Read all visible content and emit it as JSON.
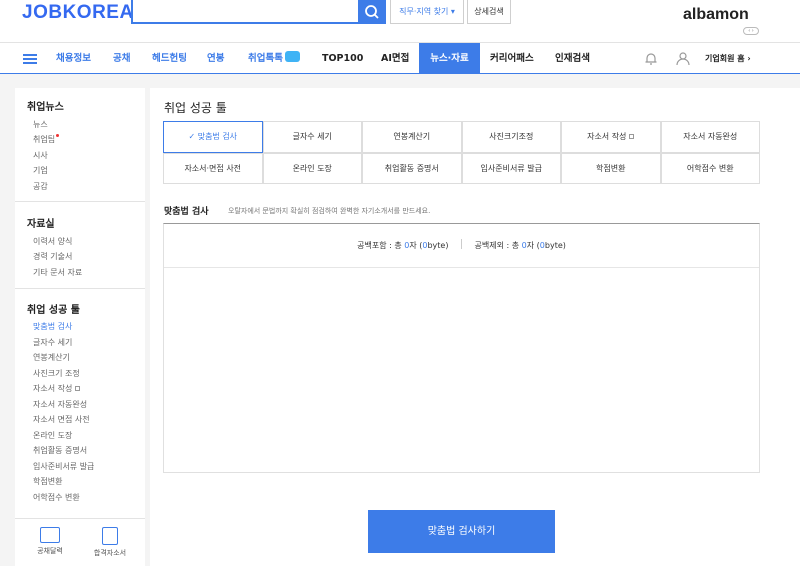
{
  "header": {
    "logo": "JOBKOREA",
    "search_placeholder": "",
    "job_region_button": "직무·지역 찾기 ▾",
    "detail_search_button": "상세검색",
    "albamon_logo": "albamon",
    "albamon_toggle": "‹ ›"
  },
  "nav": {
    "items": [
      "채용정보",
      "공채",
      "헤드헌팅",
      "연봉",
      "취업톡톡",
      "TOP100",
      "AI면접",
      "뉴스·자료",
      "커리어패스",
      "인재검색"
    ],
    "corporate_home": "기업회원 홈 ›"
  },
  "sidebar": {
    "news_title": "취업뉴스",
    "news_items": [
      "뉴스",
      "취업팁",
      "시사",
      "기업",
      "공감"
    ],
    "resource_title": "자료실",
    "resource_items": [
      "이력서 양식",
      "경력 기술서",
      "기타 문서 자료"
    ],
    "tools_title": "취업 성공 툴",
    "tools_items": [
      "맞춤법 검사",
      "글자수 세기",
      "연봉계산기",
      "사진크기 조정",
      "자소서 작성",
      "자소서 자동완성",
      "자소서 면접 사전",
      "온라인 도장",
      "취업활동 증명서",
      "입사준비서류 발급",
      "학점변환",
      "어학점수 변환"
    ],
    "bottom_tools": [
      "공채달력",
      "합격자소서"
    ]
  },
  "main": {
    "title": "취업 성공 툴",
    "tools_row1": [
      "맞춤법 검사",
      "글자수 세기",
      "연봉계산기",
      "사진크기조정",
      "자소서 작성",
      "자소서 자동완성"
    ],
    "tools_row2": [
      "자소서·면접 사전",
      "온라인 도장",
      "취업활동 증명서",
      "입사준비서류 발급",
      "학점변환",
      "어학점수 변환"
    ],
    "section_title": "맞춤법 검사",
    "section_desc": "오탈자에서 문법까지 확실히 점검하여 완벽한 자기소개서를 만드세요.",
    "count_with_space_label": "공백포함 : 총 ",
    "count_with_space_value": "0",
    "count_without_space_label": "공백제외 : 총 ",
    "count_without_space_value": "0",
    "char_unit": "자 (",
    "byte_unit": "byte)",
    "check_button": "맞춤법 검사하기"
  },
  "colors": {
    "accent": "#3d7ce8"
  }
}
